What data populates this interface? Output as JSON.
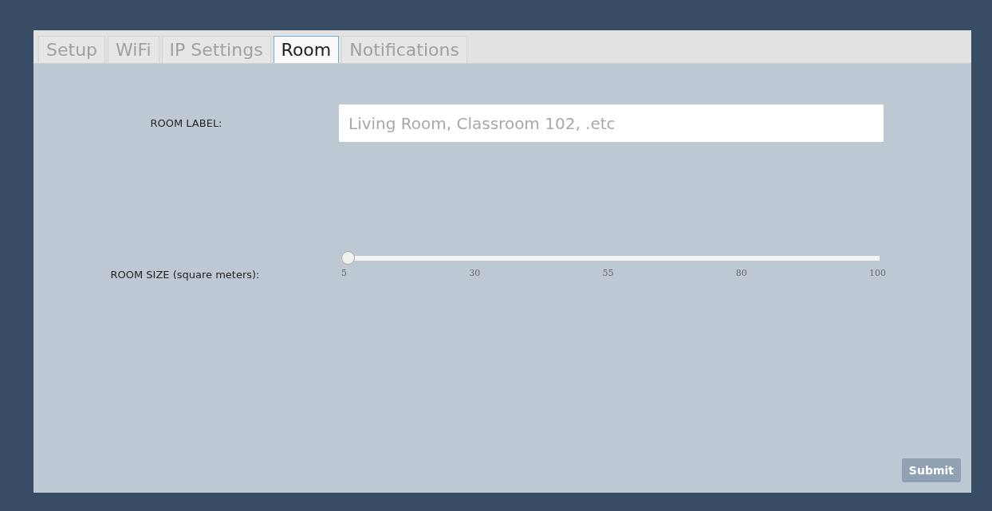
{
  "tabs": [
    {
      "label": "Setup",
      "selected": false
    },
    {
      "label": "WiFi",
      "selected": false
    },
    {
      "label": "IP Settings",
      "selected": false
    },
    {
      "label": "Room",
      "selected": true
    },
    {
      "label": "Notifications",
      "selected": false
    }
  ],
  "room_label": {
    "label": "ROOM LABEL:",
    "placeholder": "Living Room, Classroom 102, .etc"
  },
  "room_size": {
    "label": "ROOM SIZE (square meters):",
    "level": 0,
    "ticks": [
      "5",
      "30",
      "55",
      "80",
      "100"
    ]
  },
  "submit": {
    "label": "Submit"
  }
}
